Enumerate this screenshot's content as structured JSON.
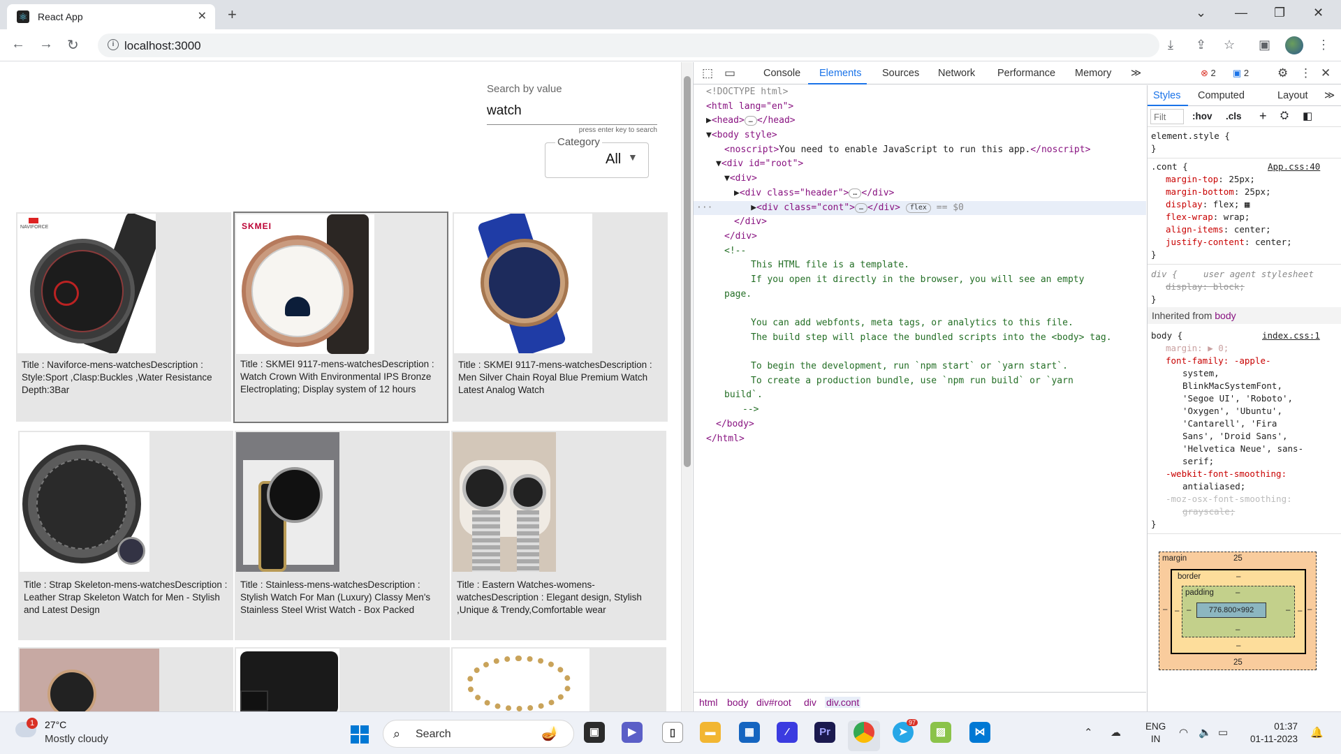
{
  "browser": {
    "tab_title": "React App",
    "url": "localhost:3000"
  },
  "page": {
    "search_label": "Search by value",
    "search_value": "watch",
    "search_hint": "press enter key to search",
    "category_label": "Category",
    "category_value": "All",
    "brand_logos": [
      "NAVIFORCE",
      "SKMEI"
    ],
    "products": [
      {
        "text": "Title : Naviforce-mens-watchesDescription : Style:Sport ,Clasp:Buckles ,Water Resistance Depth:3Bar"
      },
      {
        "text": "Title : SKMEI 9117-mens-watchesDescription : Watch Crown With Environmental IPS Bronze Electroplating; Display system of 12 hours"
      },
      {
        "text": "Title : SKMEI 9117-mens-watchesDescription : Men Silver Chain Royal Blue Premium Watch Latest Analog Watch"
      },
      {
        "text": "Title : Strap Skeleton-mens-watchesDescription : Leather Strap Skeleton Watch for Men - Stylish and Latest Design"
      },
      {
        "text": "Title : Stainless-mens-watchesDescription : Stylish Watch For Man (Luxury) Classy Men's Stainless Steel Wrist Watch - Box Packed"
      },
      {
        "text": "Title : Eastern Watches-womens-watchesDescription : Elegant design, Stylish ,Unique & Trendy,Comfortable wear"
      },
      {
        "text": ""
      },
      {
        "text": ""
      },
      {
        "text": ""
      }
    ]
  },
  "devtools": {
    "tabs": [
      "Console",
      "Elements",
      "Sources",
      "Network",
      "Performance",
      "Memory"
    ],
    "active_tab": "Elements",
    "error_count": "2",
    "message_count": "2",
    "dom": {
      "doctype": "<!DOCTYPE html>",
      "html_open": "<html lang=\"en\">",
      "head": "<head>",
      "head_close": "</head>",
      "body_open": "<body style>",
      "noscript": "You need to enable JavaScript to run this app.",
      "root": "<div id=\"root\">",
      "div_open": "<div>",
      "header": "<div class=\"header\">",
      "cont": "<div class=\"cont\">",
      "div_close": "</div>",
      "cont_pill": "flex",
      "cont_suffix": "== $0",
      "comment_lines": [
        "<!--",
        "This HTML file is a template.",
        "If you open it directly in the browser, you will see an empty",
        "page.",
        "",
        "You can add webfonts, meta tags, or analytics to this file.",
        "The build step will place the bundled scripts into the <body> tag.",
        "",
        "To begin the development, run `npm start` or `yarn start`.",
        "To create a production bundle, use `npm run build` or `yarn",
        "build`.",
        "-->"
      ],
      "body_close": "</body>",
      "html_close": "</html>"
    },
    "breadcrumbs": [
      "html",
      "body",
      "div#root",
      "div",
      "div.cont"
    ],
    "styles": {
      "tabs": [
        "Styles",
        "Computed",
        "Layout"
      ],
      "filter_placeholder": "Filt",
      "hov": ":hov",
      "cls": ".cls",
      "element_style": "element.style {",
      "cont_selector": ".cont {",
      "cont_source": "App.css:40",
      "cont_props": [
        {
          "name": "margin-top",
          "value": "25px;"
        },
        {
          "name": "margin-bottom",
          "value": "25px;"
        },
        {
          "name": "display",
          "value": "flex;"
        },
        {
          "name": "flex-wrap",
          "value": "wrap;"
        },
        {
          "name": "align-items",
          "value": "center;"
        },
        {
          "name": "justify-content",
          "value": "center;"
        }
      ],
      "div_selector": "div {",
      "ua_label": "user agent stylesheet",
      "div_prop": "display: block;",
      "inherited_from": "Inherited from",
      "inherited_el": "body",
      "body_selector": "body {",
      "body_source": "index.css:1",
      "body_margin": "margin: ▶ 0;",
      "font_family_lines": [
        "font-family: -apple-",
        "system,",
        "BlinkMacSystemFont,",
        "'Segoe UI', 'Roboto',",
        "'Oxygen', 'Ubuntu',",
        "'Cantarell', 'Fira",
        "Sans', 'Droid Sans',",
        "'Helvetica Neue', sans-",
        "serif;"
      ],
      "smoothing_prop": "-webkit-font-smoothing:",
      "smoothing_val": "antialiased;",
      "moz_prop": "-moz-osx-font-smoothing:",
      "moz_val": "grayscale;",
      "box": {
        "margin_label": "margin",
        "margin_top": "25",
        "margin_bottom": "25",
        "border_label": "border",
        "padding_label": "padding",
        "dash": "–",
        "content": "776.800×992"
      }
    }
  },
  "taskbar": {
    "temperature": "27°C",
    "weather": "Mostly cloudy",
    "weather_alert": "1",
    "search_label": "Search",
    "telegram_badge": "97",
    "lang_top": "ENG",
    "lang_bottom": "IN",
    "time": "01:37",
    "date": "01-11-2023"
  }
}
